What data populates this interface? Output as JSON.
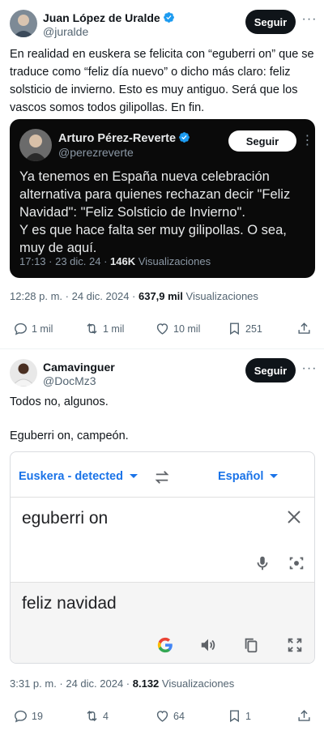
{
  "post1": {
    "name": "Juan López de Uralde",
    "handle": "@juralde",
    "follow_label": "Seguir",
    "text": "En realidad en euskera se felicita con “eguberri on” que se traduce como “feliz día nuevo” o dicho más claro: feliz solsticio de invierno. Esto es muy antiguo. Será que los vascos somos todos gilipollas. En fin.",
    "quote": {
      "name": "Arturo Pérez-Reverte",
      "handle": "@perezreverte",
      "follow_label": "Seguir",
      "text_lines": [
        "Ya tenemos en España nueva celebración",
        "alternativa para quienes rechazan decir \"Feliz",
        "Navidad\": \"Feliz Solsticio de Invierno\".",
        "Y es que hace falta ser muy gilipollas. O sea,",
        "muy de aquí."
      ],
      "time": "17:13 · 23 dic. 24 · ",
      "views_count": "146K",
      "views_label": " Visualizaciones"
    },
    "meta_time": "12:28 p. m. · 24 dic. 2024 · ",
    "views_count": "637,9 mil",
    "views_label": " Visualizaciones",
    "replies": "1 mil",
    "reposts": "1 mil",
    "likes": "10 mil",
    "bookmarks": "251"
  },
  "post2": {
    "name": "Camavinguer",
    "handle": "@DocMz3",
    "follow_label": "Seguir",
    "text_line1": "Todos no, algunos.",
    "text_line2": "Eguberri on, campeón.",
    "translate": {
      "source_lang": "Euskera - detected",
      "target_lang": "Español",
      "source_text": "eguberri on",
      "translated_text": "feliz navidad"
    },
    "meta_time": "3:31 p. m. · 24 dic. 2024 · ",
    "views_count": "8.132",
    "views_label": " Visualizaciones",
    "replies": "19",
    "reposts": "4",
    "likes": "64",
    "bookmarks": "1"
  },
  "colors": {
    "verified": "#1d9bf0",
    "google_blue": "#1a73e8",
    "text_secondary": "#536471"
  }
}
